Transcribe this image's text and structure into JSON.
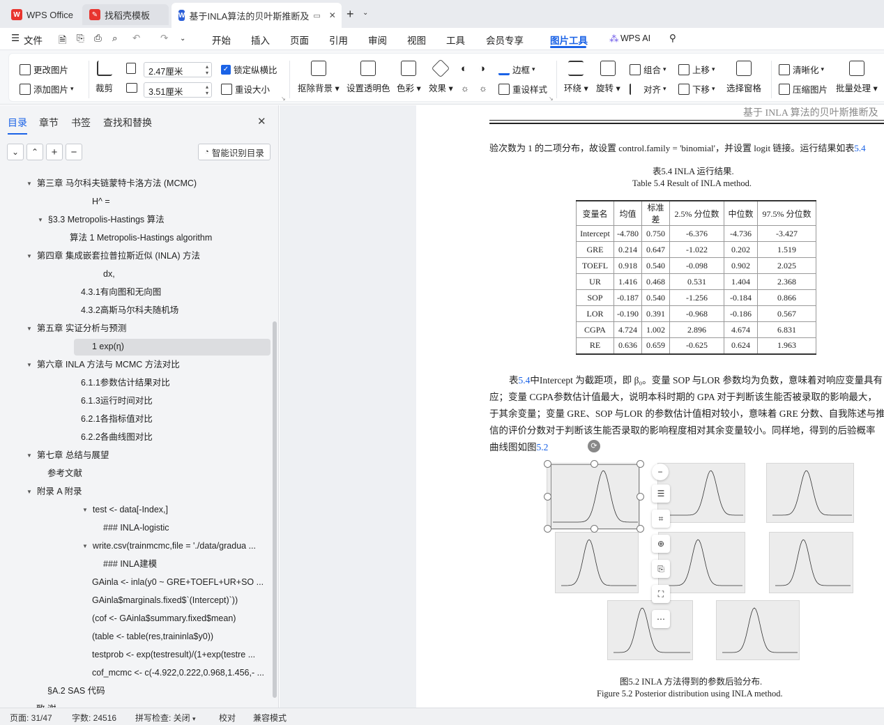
{
  "tabs": [
    {
      "label": "WPS Office"
    },
    {
      "label": "找稻壳模板"
    },
    {
      "label": "基于INLA算法的贝叶斯推断及"
    }
  ],
  "menu": {
    "file": "文件",
    "items": [
      "开始",
      "插入",
      "页面",
      "引用",
      "审阅",
      "视图",
      "工具",
      "会员专享",
      "图片工具"
    ],
    "ai": "WPS AI"
  },
  "ribbon": {
    "change_image": "更改图片",
    "add_image": "添加图片",
    "crop": "裁剪",
    "width_value": "2.47厘米",
    "height_value": "3.51厘米",
    "lock_ratio": "锁定纵横比",
    "resize": "重设大小",
    "remove_bg": "抠除背景",
    "set_transparent": "设置透明色",
    "color": "色彩",
    "effects": "效果",
    "border": "边框",
    "reset_style": "重设样式",
    "wrap": "环绕",
    "rotate": "旋转",
    "group": "组合",
    "align": "对齐",
    "bring_forward": "上移",
    "send_backward": "下移",
    "selection_pane": "选择窗格",
    "sharpen": "清晰化",
    "compress": "压缩图片",
    "batch": "批量处理"
  },
  "sidebar": {
    "tabs": [
      "目录",
      "章节",
      "书签",
      "查找和替换"
    ],
    "smart_toc": "智能识别目录",
    "toc": [
      "第三章 马尔科夫链蒙特卡洛方法 (MCMC)",
      "H^ =",
      "§3.3 Metropolis-Hastings 算法",
      "算法 1 Metropolis-Hastings algorithm",
      "第四章 集成嵌套拉普拉斯近似 (INLA) 方法",
      "dx,",
      "4.3.1有向图和无向图",
      "4.3.2高斯马尔科夫随机场",
      "第五章 实证分析与预测",
      "1 exp(η)",
      "第六章 INLA 方法与 MCMC 方法对比",
      "6.1.1参数估计结果对比",
      "6.1.3运行时间对比",
      "6.2.1各指标值对比",
      "6.2.2各曲线图对比",
      "第七章 总结与展望",
      "参考文献",
      "附录 A 附录",
      "test <- data[-Index,]",
      "### INLA-logistic",
      "write.csv(trainmcmc,file = './data/gradua ...",
      "### INLA建模",
      "GAinla <- inla(y0 ~ GRE+TOEFL+UR+SO ...",
      "GAinla$marginals.fixed$`(Intercept)`))",
      "(cof <- GAinla$summary.fixed$mean)",
      "(table <- table(res,traininla$y0))",
      "testprob <- exp(testresult)/(1+exp(testre ...",
      "cof_mcmc <- c(-4.922,0.222,0.968,1.456,- ...",
      "§A.2 SAS 代码",
      "致 谢"
    ]
  },
  "doc": {
    "header": "基于 INLA 算法的贝叶斯推断及",
    "line1_pre": "验次数为 1 的二项分布，故设置 control.family = 'binomial'，并设置 logit 链接。运行结果如表",
    "line1_ref": "5.4",
    "table_caption_cn": "表5.4    INLA 运行结果.",
    "table_caption_en": "Table 5.4    Result of INLA method.",
    "table_headers": [
      "变量名",
      "均值",
      "标准差",
      "2.5% 分位数",
      "中位数",
      "97.5% 分位数"
    ],
    "table_rows": [
      [
        "Intercept",
        "-4.780",
        "0.750",
        "-6.376",
        "-4.736",
        "-3.427"
      ],
      [
        "GRE",
        "0.214",
        "0.647",
        "-1.022",
        "0.202",
        "1.519"
      ],
      [
        "TOEFL",
        "0.918",
        "0.540",
        "-0.098",
        "0.902",
        "2.025"
      ],
      [
        "UR",
        "1.416",
        "0.468",
        "0.531",
        "1.404",
        "2.368"
      ],
      [
        "SOP",
        "-0.187",
        "0.540",
        "-1.256",
        "-0.184",
        "0.866"
      ],
      [
        "LOR",
        "-0.190",
        "0.391",
        "-0.968",
        "-0.186",
        "0.567"
      ],
      [
        "CGPA",
        "4.724",
        "1.002",
        "2.896",
        "4.674",
        "6.831"
      ],
      [
        "RE",
        "0.636",
        "0.659",
        "-0.625",
        "0.624",
        "1.963"
      ]
    ],
    "para1_a": "表",
    "para1_ref": "5.4",
    "para1_b": "中Intercept 为截距项，即 β₀。变量 SOP 与LOR 参数均为负数，意味着对响应变量具有",
    "para2": "应；变量 CGPA参数估计值最大，说明本科时期的 GPA 对于判断该生能否被录取的影响最大，",
    "para3": "于其余变量；变量 GRE、SOP 与LOR 的参数估计值相对较小，意味着 GRE 分数、自我陈述与推",
    "para4": "信的评价分数对于判断该生能否录取的影响程度相对其余变量较小。同样地，得到的后验概率",
    "para5_a": "曲线图如图",
    "para5_ref": "5.2",
    "fig_caption_cn": "图5.2    INLA 方法得到的参数后验分布.",
    "fig_caption_en": "Figure 5.2    Posterior distribution using INLA method."
  },
  "status": {
    "page": "页面: 31/47",
    "words": "字数: 24516",
    "spell": "拼写检查: 关闭",
    "proof": "校对",
    "compat": "兼容模式"
  }
}
